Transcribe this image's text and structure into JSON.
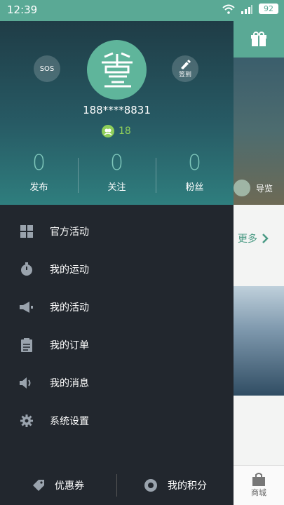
{
  "status_bar": {
    "time": "12:39",
    "battery": "92"
  },
  "drawer": {
    "sos_label": "SOS",
    "checkin_label": "签到",
    "phone": "188****8831",
    "level": "18",
    "stats": [
      {
        "value": "0",
        "label": "发布"
      },
      {
        "value": "0",
        "label": "关注"
      },
      {
        "value": "0",
        "label": "粉丝"
      }
    ],
    "menu": [
      {
        "label": "官方活动",
        "icon": "grid-icon"
      },
      {
        "label": "我的运动",
        "icon": "stopwatch-icon"
      },
      {
        "label": "我的活动",
        "icon": "megaphone-icon"
      },
      {
        "label": "我的订单",
        "icon": "clipboard-icon"
      },
      {
        "label": "我的消息",
        "icon": "speaker-icon"
      },
      {
        "label": "系统设置",
        "icon": "gear-icon"
      }
    ],
    "footer": {
      "coupon": "优惠券",
      "points": "我的积分"
    }
  },
  "background": {
    "guide": "导览",
    "more": "更多",
    "mall": "商城"
  },
  "colors": {
    "accent": "#5aa995",
    "drawer_bg": "#22272e",
    "level": "#8fcf5a"
  }
}
